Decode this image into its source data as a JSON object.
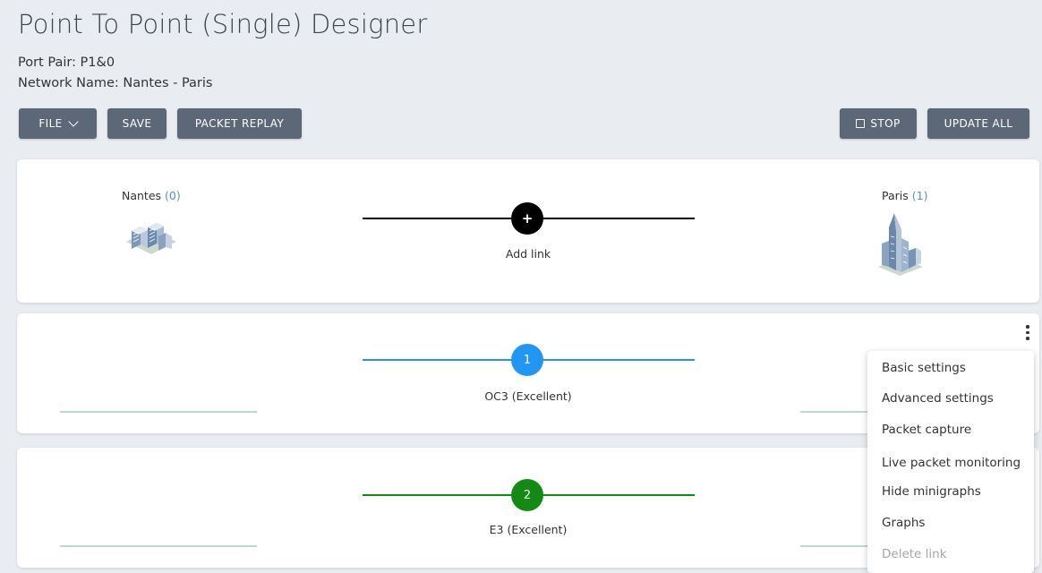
{
  "header": {
    "title": "Point To Point (Single) Designer",
    "port_pair": "Port Pair: P1&0",
    "network_name": "Network Name: Nantes - Paris"
  },
  "toolbar": {
    "file_label": "FILE",
    "save_label": "SAVE",
    "packet_replay_label": "PACKET REPLAY",
    "stop_label": "STOP",
    "update_all_label": "UPDATE ALL"
  },
  "sites": {
    "left": {
      "name": "Nantes",
      "count": "(0)",
      "icon": "office-buildings-icon"
    },
    "right": {
      "name": "Paris",
      "count": "(1)",
      "icon": "skyscraper-icon"
    }
  },
  "add_link": {
    "symbol": "+",
    "label": "Add link"
  },
  "links": [
    {
      "number": "1",
      "label": "OC3 (Excellent)",
      "color": "#2196f3"
    },
    {
      "number": "2",
      "label": "E3 (Excellent)",
      "color": "#138a13"
    }
  ],
  "context_menu": {
    "items": [
      {
        "label": "Basic settings",
        "disabled": false
      },
      {
        "label": "Advanced settings",
        "disabled": false
      },
      {
        "label": "Packet capture",
        "disabled": false
      },
      {
        "label": "Live packet monitoring",
        "disabled": false
      },
      {
        "label": "Hide minigraphs",
        "disabled": false
      },
      {
        "label": "Graphs",
        "disabled": false
      },
      {
        "label": "Delete link",
        "disabled": true
      }
    ]
  },
  "colors": {
    "button_bg": "#5c6778",
    "page_bg": "#e9edf2",
    "minigraph_line": "#b7dccd"
  }
}
